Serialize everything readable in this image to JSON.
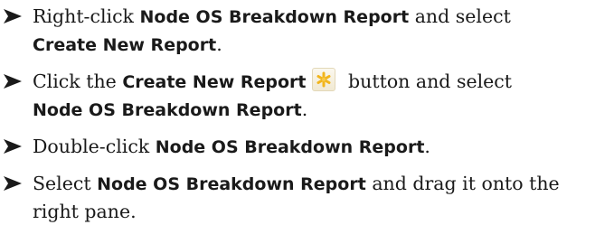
{
  "steps": [
    {
      "pre": "Right-click ",
      "b1": "Node OS Breakdown Report",
      "mid": " and select ",
      "b2": "Create New Report",
      "post": "."
    },
    {
      "pre": "Click the ",
      "b1": "Create New Report",
      "mid": " button and select ",
      "b2": "Node OS Breakdown Report",
      "post": "."
    },
    {
      "pre": "Double-click ",
      "b1": "Node OS Breakdown Report",
      "post": "."
    },
    {
      "pre": "Select ",
      "b1": "Node OS Breakdown Report",
      "mid": " and drag it onto the right pane."
    }
  ],
  "icons": {
    "bullet": "arrowhead-bullet-icon",
    "create_report": "asterisk-star-icon"
  },
  "colors": {
    "text": "#1a1a1a",
    "icon_star": "#f2b51c"
  }
}
